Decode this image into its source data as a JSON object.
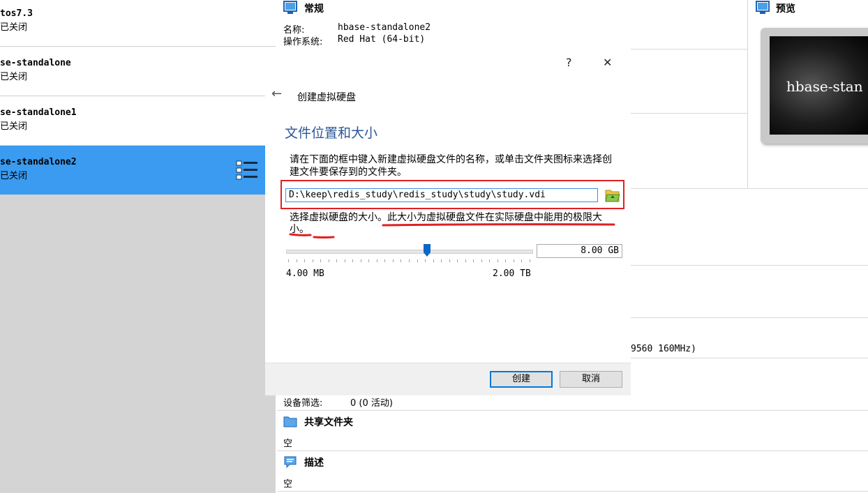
{
  "vm_list": [
    {
      "name": "tos7.3",
      "state": "已关闭"
    },
    {
      "name": "se-standalone",
      "state": "已关闭"
    },
    {
      "name": "se-standalone1",
      "state": "已关闭"
    },
    {
      "name": "se-standalone2",
      "state": "已关闭",
      "selected": true
    }
  ],
  "details": {
    "general": {
      "title": "常规",
      "name_label": "名称:",
      "name_value": "hbase-standalone2",
      "os_label": "操作系统:",
      "os_value": "Red Hat (64-bit)"
    },
    "preview": {
      "title": "预览",
      "screen_text": "hbase-stan"
    },
    "cpu_fragment": "9560 160MHz)",
    "usb": {
      "filter_label": "设备筛选:",
      "filter_value": "0 (0 活动)"
    },
    "shared_folders": {
      "title": "共享文件夹",
      "value": "空"
    },
    "description": {
      "title": "描述",
      "value": "空"
    }
  },
  "dialog": {
    "help": "?",
    "close": "✕",
    "back": "←",
    "title": "创建虚拟硬盘",
    "heading": "文件位置和大小",
    "desc": "请在下面的框中键入新建虚拟硬盘文件的名称，或单击文件夹图标来选择创建文件要保存到的文件夹。",
    "path": "D:\\keep\\redis_study\\redis_study\\study\\study.vdi",
    "size_desc": "选择虚拟硬盘的大小。此大小为虚拟硬盘文件在实际硬盘中能用的极限大小。",
    "size_value": "8.00 GB",
    "size_min": "4.00 MB",
    "size_max": "2.00 TB",
    "slider_fraction": 0.575,
    "create": "创建",
    "cancel": "取消"
  },
  "colors": {
    "selected": "#3a9bf0",
    "accent": "#2b5797",
    "annotation": "#e02020"
  }
}
